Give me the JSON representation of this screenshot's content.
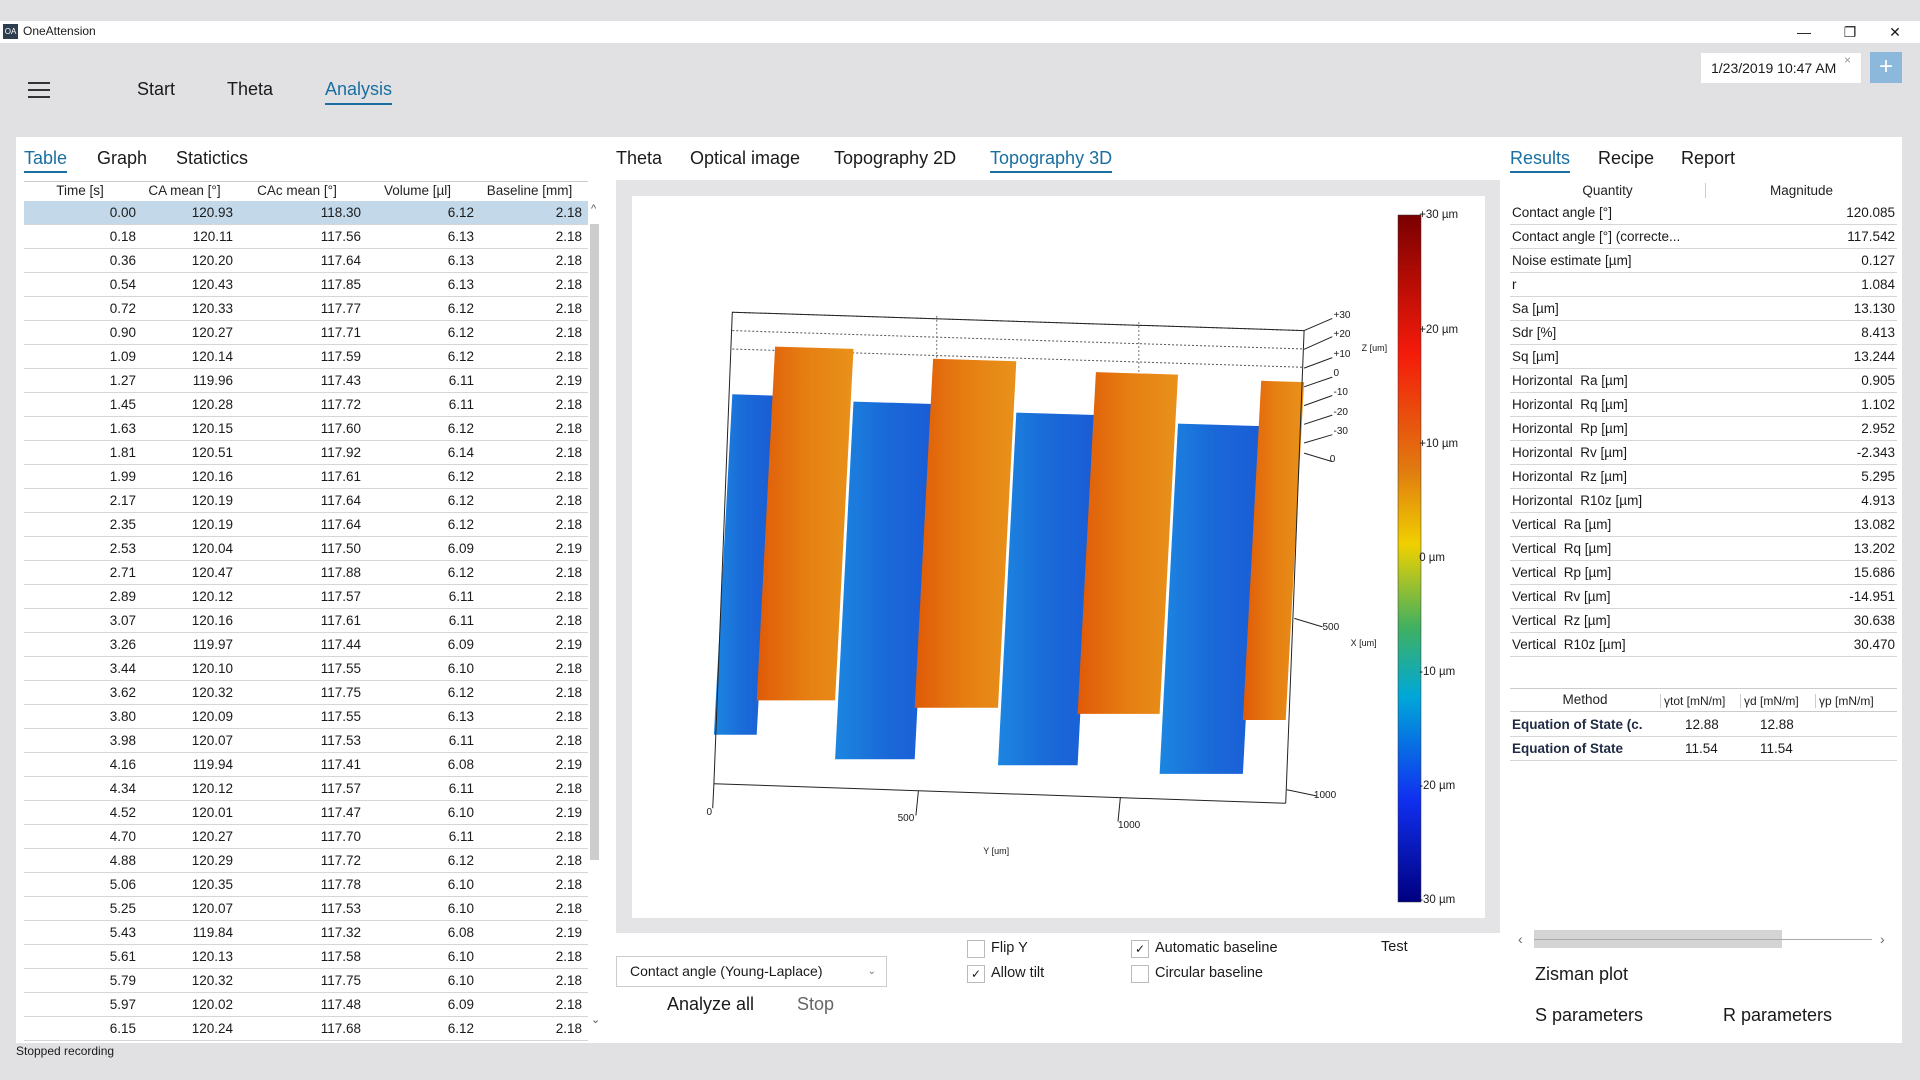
{
  "window": {
    "title": "OneAttension",
    "logo": "OA",
    "minimize": "—",
    "restore": "❐",
    "close": "✕"
  },
  "nav": {
    "items": [
      "Start",
      "Theta",
      "Analysis"
    ],
    "active": "Analysis",
    "date": "1/23/2019 10:47 AM",
    "date_clear": "×",
    "add": "+"
  },
  "left": {
    "tabs": [
      "Table",
      "Graph",
      "Statictics"
    ],
    "columns": [
      "Time [s]",
      "CA mean [°]",
      "CAc mean [°]",
      "Volume [µl]",
      "Baseline [mm]"
    ],
    "rows": [
      [
        "0.00",
        "120.93",
        "118.30",
        "6.12",
        "2.18"
      ],
      [
        "0.18",
        "120.11",
        "117.56",
        "6.13",
        "2.18"
      ],
      [
        "0.36",
        "120.20",
        "117.64",
        "6.13",
        "2.18"
      ],
      [
        "0.54",
        "120.43",
        "117.85",
        "6.13",
        "2.18"
      ],
      [
        "0.72",
        "120.33",
        "117.77",
        "6.12",
        "2.18"
      ],
      [
        "0.90",
        "120.27",
        "117.71",
        "6.12",
        "2.18"
      ],
      [
        "1.09",
        "120.14",
        "117.59",
        "6.12",
        "2.18"
      ],
      [
        "1.27",
        "119.96",
        "117.43",
        "6.11",
        "2.19"
      ],
      [
        "1.45",
        "120.28",
        "117.72",
        "6.11",
        "2.18"
      ],
      [
        "1.63",
        "120.15",
        "117.60",
        "6.12",
        "2.18"
      ],
      [
        "1.81",
        "120.51",
        "117.92",
        "6.14",
        "2.18"
      ],
      [
        "1.99",
        "120.16",
        "117.61",
        "6.12",
        "2.18"
      ],
      [
        "2.17",
        "120.19",
        "117.64",
        "6.12",
        "2.18"
      ],
      [
        "2.35",
        "120.19",
        "117.64",
        "6.12",
        "2.18"
      ],
      [
        "2.53",
        "120.04",
        "117.50",
        "6.09",
        "2.19"
      ],
      [
        "2.71",
        "120.47",
        "117.88",
        "6.12",
        "2.18"
      ],
      [
        "2.89",
        "120.12",
        "117.57",
        "6.11",
        "2.18"
      ],
      [
        "3.07",
        "120.16",
        "117.61",
        "6.11",
        "2.18"
      ],
      [
        "3.26",
        "119.97",
        "117.44",
        "6.09",
        "2.19"
      ],
      [
        "3.44",
        "120.10",
        "117.55",
        "6.10",
        "2.18"
      ],
      [
        "3.62",
        "120.32",
        "117.75",
        "6.12",
        "2.18"
      ],
      [
        "3.80",
        "120.09",
        "117.55",
        "6.13",
        "2.18"
      ],
      [
        "3.98",
        "120.07",
        "117.53",
        "6.11",
        "2.18"
      ],
      [
        "4.16",
        "119.94",
        "117.41",
        "6.08",
        "2.19"
      ],
      [
        "4.34",
        "120.12",
        "117.57",
        "6.11",
        "2.18"
      ],
      [
        "4.52",
        "120.01",
        "117.47",
        "6.10",
        "2.19"
      ],
      [
        "4.70",
        "120.27",
        "117.70",
        "6.11",
        "2.18"
      ],
      [
        "4.88",
        "120.29",
        "117.72",
        "6.12",
        "2.18"
      ],
      [
        "5.06",
        "120.35",
        "117.78",
        "6.10",
        "2.18"
      ],
      [
        "5.25",
        "120.07",
        "117.53",
        "6.10",
        "2.18"
      ],
      [
        "5.43",
        "119.84",
        "117.32",
        "6.08",
        "2.19"
      ],
      [
        "5.61",
        "120.13",
        "117.58",
        "6.10",
        "2.18"
      ],
      [
        "5.79",
        "120.32",
        "117.75",
        "6.10",
        "2.18"
      ],
      [
        "5.97",
        "120.02",
        "117.48",
        "6.09",
        "2.18"
      ],
      [
        "6.15",
        "120.24",
        "117.68",
        "6.12",
        "2.18"
      ]
    ],
    "selected_row": 0,
    "scroll_up": "^",
    "scroll_down": "⌄"
  },
  "middle": {
    "tabs": [
      "Theta",
      "Optical image",
      "Topography 2D",
      "Topography 3D"
    ],
    "active": "Topography 3D",
    "plot": {
      "z_ticks": [
        "+30",
        "+20",
        "+10",
        "0",
        "-10",
        "-20",
        "-30"
      ],
      "z_label": "Z [um]",
      "x_ticks": [
        "0",
        "500",
        "1000"
      ],
      "x_label": "X [um]",
      "y_ticks": [
        "0",
        "500",
        "1000"
      ],
      "y_label": "Y [um]",
      "colorbar_labels": [
        "+30 µm",
        "+20 µm",
        "+10 µm",
        "0 µm",
        "-10 µm",
        "-20 µm",
        "-30 µm"
      ],
      "colors": {
        "high": "#e07a10",
        "low": "#1e74d8"
      }
    },
    "method_select": "Contact angle (Young-Laplace)",
    "analyze_all": "Analyze all",
    "stop": "Stop",
    "checks": [
      {
        "label": "Flip Y",
        "checked": false
      },
      {
        "label": "Allow tilt",
        "checked": true
      },
      {
        "label": "Automatic baseline",
        "checked": true
      },
      {
        "label": "Circular baseline",
        "checked": false
      }
    ],
    "test": "Test"
  },
  "right": {
    "tabs": [
      "Results",
      "Recipe",
      "Report"
    ],
    "active": "Results",
    "columns": [
      "Quantity",
      "Magnitude"
    ],
    "results": [
      [
        "Contact angle [°]",
        "120.085"
      ],
      [
        "Contact angle [°] (correcte...",
        "117.542"
      ],
      [
        "Noise estimate [µm]",
        "0.127"
      ],
      [
        "r",
        "1.084"
      ],
      [
        "Sa [µm]",
        "13.130"
      ],
      [
        "Sdr [%]",
        "8.413"
      ],
      [
        "Sq [µm]",
        "13.244"
      ],
      [
        "Horizontal  Ra [µm]",
        "0.905"
      ],
      [
        "Horizontal  Rq [µm]",
        "1.102"
      ],
      [
        "Horizontal  Rp [µm]",
        "2.952"
      ],
      [
        "Horizontal  Rv [µm]",
        "-2.343"
      ],
      [
        "Horizontal  Rz [µm]",
        "5.295"
      ],
      [
        "Horizontal  R10z [µm]",
        "4.913"
      ],
      [
        "Vertical  Ra [µm]",
        "13.082"
      ],
      [
        "Vertical  Rq [µm]",
        "13.202"
      ],
      [
        "Vertical  Rp [µm]",
        "15.686"
      ],
      [
        "Vertical  Rv [µm]",
        "-14.951"
      ],
      [
        "Vertical  Rz [µm]",
        "30.638"
      ],
      [
        "Vertical  R10z [µm]",
        "30.470"
      ]
    ],
    "method_columns": [
      "Method",
      "γtot [mN/m]",
      "γd [mN/m]",
      "γp [mN/m]"
    ],
    "methods": [
      [
        "Equation of State (c.",
        "12.88",
        "12.88",
        ""
      ],
      [
        "Equation of State",
        "11.54",
        "11.54",
        ""
      ]
    ],
    "zisman": "Zisman plot",
    "s_params": "S parameters",
    "r_params": "R parameters"
  },
  "status": "Stopped recording"
}
